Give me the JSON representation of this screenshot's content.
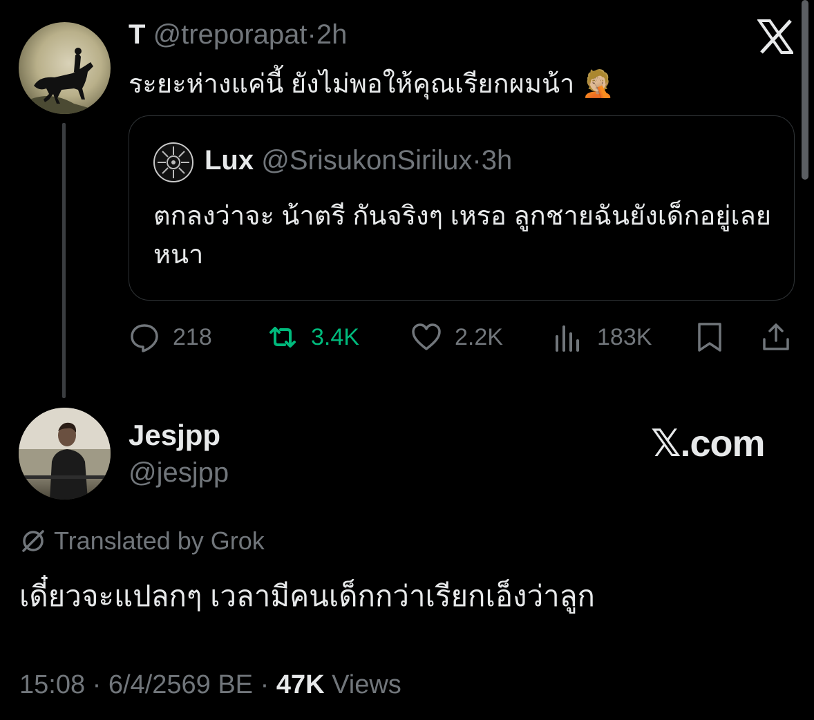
{
  "parent_tweet": {
    "display_name": "T",
    "handle": "@treporapat",
    "separator": "·",
    "time": "2h",
    "text": "ระยะห่างแค่นี้ ยังไม่พอให้คุณเรียกผมน้า",
    "emoji": "🤦🏼"
  },
  "quoted_tweet": {
    "display_name": "Lux",
    "handle": "@SrisukonSirilux",
    "separator": "·",
    "time": "3h",
    "text": "ตกลงว่าจะ น้าตรี กันจริงๆ เหรอ ลูกชายฉันยังเด็กอยู่เลยหนา"
  },
  "actions": {
    "replies": "218",
    "reposts": "3.4K",
    "likes": "2.2K",
    "views": "183K"
  },
  "main_tweet": {
    "display_name": "Jesjpp",
    "handle": "@jesjpp",
    "brand": "𝕏.com",
    "translated_label": "Translated by Grok",
    "text": "เดี๋ยวจะแปลกๆ เวลามีคนเด็กกว่าเรียกเอ็งว่าลูก",
    "timestamp": "15:08 · 6/4/2569 BE ·",
    "views_count": "47K",
    "views_label": "Views"
  },
  "colors": {
    "background": "#000000",
    "text": "#e7e9ea",
    "muted": "#71767b",
    "repost_green": "#00ba7c",
    "border": "#2f3336"
  },
  "icons": [
    "x-logo-icon",
    "reply-icon",
    "repost-icon",
    "like-icon",
    "views-icon",
    "bookmark-icon",
    "share-icon",
    "translate-icon"
  ]
}
